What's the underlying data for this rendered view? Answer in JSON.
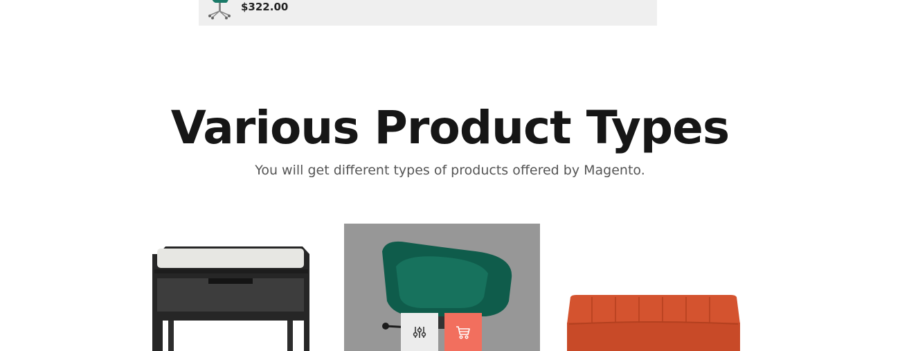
{
  "mini_cart": {
    "price": "$322.00",
    "thumb_icon": "office-chair-thumbnail"
  },
  "section": {
    "title": "Various Product Types",
    "subtitle": "You will get different types of products offered by Magento."
  },
  "products": [
    {
      "image": "nightstand-image"
    },
    {
      "image": "green-chair-image",
      "actions": [
        "compare-icon",
        "cart-icon"
      ]
    },
    {
      "image": "orange-sofa-image"
    }
  ],
  "colors": {
    "cart_button": "#f26f5e",
    "compare_button": "#ececec",
    "hover_overlay": "#979797",
    "title": "#161616"
  }
}
